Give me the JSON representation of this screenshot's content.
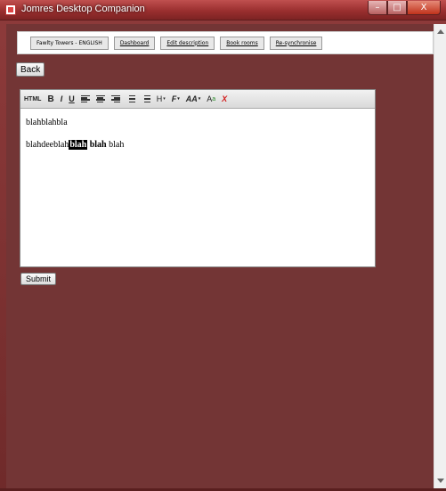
{
  "window": {
    "title": "Jomres Desktop Companion",
    "controls": {
      "minimize": "–",
      "maximize": "□",
      "close": "X"
    }
  },
  "nav": {
    "items": [
      {
        "label": "Fawlty Towers - ENGLISH",
        "link": false
      },
      {
        "label": "Dashboard",
        "link": true
      },
      {
        "label": "Edit description",
        "link": true
      },
      {
        "label": "Book rooms",
        "link": true
      },
      {
        "label": "Re-synchronise",
        "link": true
      }
    ]
  },
  "actions": {
    "back_label": "Back",
    "submit_label": "Submit"
  },
  "editor": {
    "toolbar": {
      "html": "HTML",
      "bold": "B",
      "italic": "I",
      "underline": "U",
      "heading": "H",
      "font": "F",
      "font_size": "AA",
      "font_color": "A",
      "clear": "X"
    },
    "content": {
      "line1": "blahblahbla",
      "line2_prefix": "blahdeeblah",
      "line2_selected": "blah",
      "line2_bold": "blah",
      "line2_suffix": "blah"
    }
  },
  "colors": {
    "background": "#733535",
    "accent_red": "#d21a1a"
  }
}
